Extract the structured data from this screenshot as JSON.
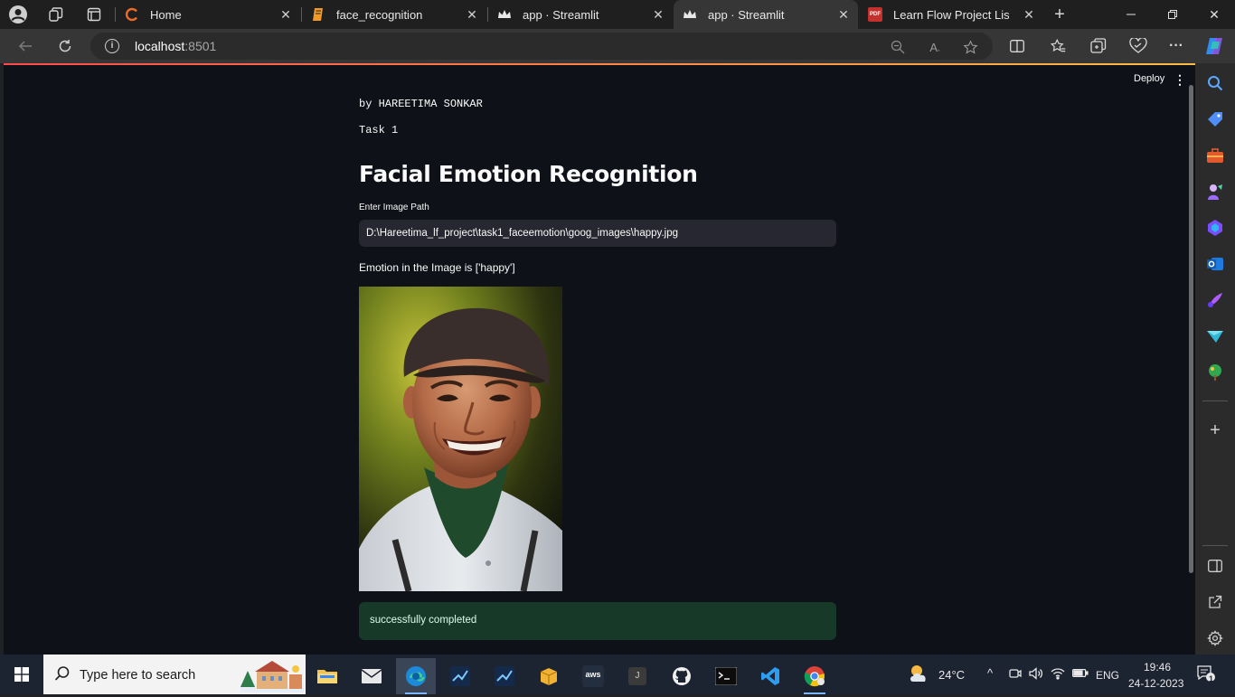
{
  "browser": {
    "tabs": [
      {
        "label": "Home",
        "favicon": "c-ring-icon",
        "active": false
      },
      {
        "label": "face_recognition",
        "favicon": "notebook-icon",
        "active": false
      },
      {
        "label": "app · Streamlit",
        "favicon": "streamlit-crown-icon",
        "active": false
      },
      {
        "label": "app · Streamlit",
        "favicon": "streamlit-crown-icon",
        "active": true
      },
      {
        "label": "Learn Flow Project List .pdf",
        "favicon": "pdf-icon",
        "active": false
      }
    ],
    "url_host": "localhost",
    "url_port": ":8501",
    "pdf_badge": "PDF"
  },
  "page": {
    "deploy_label": "Deploy",
    "byline": "by HAREETIMA SONKAR",
    "task": "Task 1",
    "title": "Facial Emotion Recognition",
    "input_label": "Enter Image Path",
    "input_value": "D:\\Hareetima_lf_project\\task1_faceemotion\\goog_images\\happy.jpg",
    "emotion_text": "Emotion in the Image is ['happy']",
    "success_text": "successfully completed"
  },
  "taskbar": {
    "search_placeholder": "Type here to search",
    "weather": "24°C",
    "language": "ENG",
    "time": "19:46",
    "date": "24-12-2023",
    "notification_count": "1",
    "aws_label": "aws",
    "jupyter_label": "J"
  },
  "colors": {
    "page_bg": "#0e1117",
    "input_bg": "#262730",
    "success_bg": "#173928",
    "accent": "#ff4b4b"
  }
}
